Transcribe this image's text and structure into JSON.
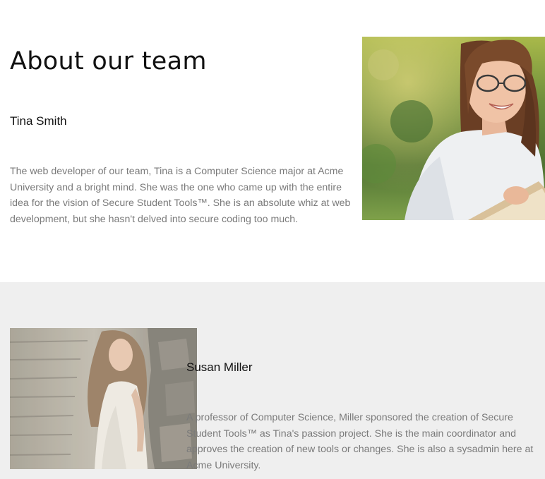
{
  "page": {
    "title": "About our team"
  },
  "team": [
    {
      "name": "Tina Smith",
      "bio": "The web developer of our team, Tina is a Computer Science major at Acme University and a bright mind. She was the one who came up with the entire idea for the vision of Secure Student Tools™. She is an absolute whiz at web development, but she hasn't delved into secure coding too much.",
      "photo_icon": "portrait-photo-icon"
    },
    {
      "name": "Susan Miller",
      "bio": "A professor of Computer Science, Miller sponsored the creation of Secure Student Tools™ as Tina's passion project. She is the main coordinator and approves the creation of new tools or changes. She is also a sysadmin here at Acme University.",
      "photo_icon": "portrait-photo-icon"
    }
  ],
  "colors": {
    "background": "#ffffff",
    "alt_section_background": "#efefef",
    "heading_text": "#111111",
    "body_text": "#7a7a7a"
  }
}
